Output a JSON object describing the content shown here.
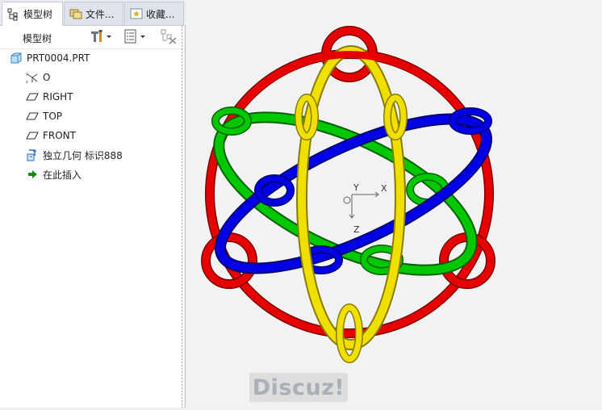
{
  "tabs": [
    {
      "label": "模型树",
      "icon": "tree-icon",
      "active": true
    },
    {
      "label": "文件...",
      "icon": "folders-icon",
      "active": false
    },
    {
      "label": "收藏...",
      "icon": "favorites-icon",
      "active": false
    }
  ],
  "toolbar": {
    "title": "模型树",
    "settings_icon": "tools-icon",
    "show_icon": "list-icon",
    "filter_icon": "filter-icon"
  },
  "tree": {
    "root": "PRT0004.PRT",
    "items": [
      {
        "label": "O",
        "icon": "csys-icon"
      },
      {
        "label": "RIGHT",
        "icon": "datum-plane-icon"
      },
      {
        "label": "TOP",
        "icon": "datum-plane-icon"
      },
      {
        "label": "FRONT",
        "icon": "datum-plane-icon"
      },
      {
        "label": "独立几何 标识888",
        "icon": "independent-geometry-icon"
      },
      {
        "label": "在此插入",
        "icon": "insert-here-arrow-icon"
      }
    ]
  },
  "viewport": {
    "csys_labels": {
      "y": "Y",
      "x": "X",
      "z": "Z"
    },
    "colors": {
      "red": "#e60000",
      "green": "#00c800",
      "blue": "#0000e6",
      "yellow": "#f0e000",
      "background": "#f2f2f2"
    }
  },
  "watermark": "Discuz!"
}
